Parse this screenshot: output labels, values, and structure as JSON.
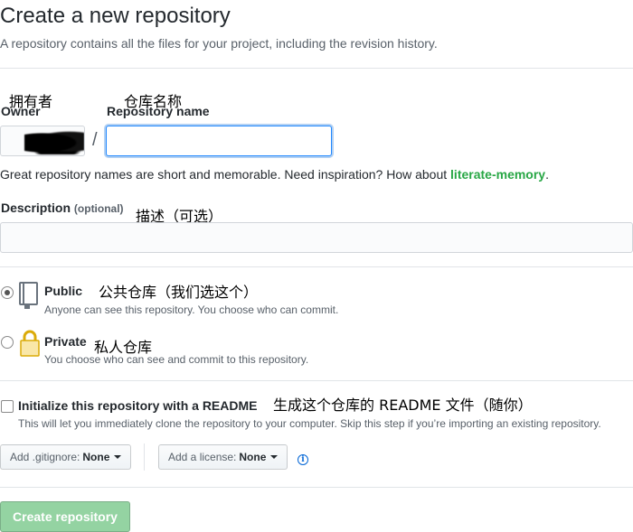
{
  "header": {
    "title": "Create a new repository",
    "subtitle": "A repository contains all the files for your project, including the revision history."
  },
  "owner": {
    "annotation": "拥有者",
    "label": "Owner"
  },
  "repo_name": {
    "annotation": "仓库名称",
    "label": "Repository name",
    "value": ""
  },
  "hint": {
    "text": "Great repository names are short and memorable. Need inspiration? How about ",
    "suggestion": "literate-memory",
    "end": "."
  },
  "description": {
    "label": "Description",
    "optional": "(optional)",
    "annotation": "描述（可选）",
    "value": ""
  },
  "visibility": {
    "public": {
      "label": "Public",
      "annotation": "公共仓库（我们选这个）",
      "desc": "Anyone can see this repository. You choose who can commit.",
      "selected": true
    },
    "private": {
      "label": "Private",
      "annotation": "私人仓库",
      "desc": "You choose who can see and commit to this repository.",
      "selected": false
    }
  },
  "readme": {
    "label": "Initialize this repository with a README",
    "annotation": "生成这个仓库的 README 文件（随你）",
    "desc": "This will let you immediately clone the repository to your computer. Skip this step if you’re importing an existing repository.",
    "checked": false
  },
  "gitignore": {
    "label": "Add .gitignore:",
    "value": "None"
  },
  "license": {
    "label": "Add a license:",
    "value": "None"
  },
  "info_icon": "i",
  "submit": {
    "label": "Create repository"
  },
  "icons": [
    "repo-book-icon",
    "lock-icon",
    "info-icon",
    "caret-down-icon"
  ]
}
